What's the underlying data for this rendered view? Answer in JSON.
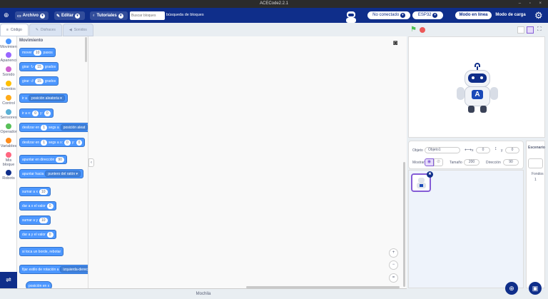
{
  "window": {
    "title": "ACECode2.2.1"
  },
  "menu": {
    "archivo": "Archivo",
    "editar": "Editar",
    "tutoriales": "Tutoriales",
    "search_placeholder": "Buscar bloques",
    "search_button": "búsqueda de bloques",
    "connection": "No conectado",
    "device": "ESP32",
    "mode_online": "Modo en línea",
    "mode_upload": "Modo de carga"
  },
  "tabs": [
    {
      "label": "Código"
    },
    {
      "label": "Disfraces"
    },
    {
      "label": "Sonidos"
    }
  ],
  "categories": [
    {
      "label": "Movimien",
      "color": "#4c97ff"
    },
    {
      "label": "Aparienci",
      "color": "#9966ff"
    },
    {
      "label": "Sonido",
      "color": "#cf63cf"
    },
    {
      "label": "Eventos",
      "color": "#ffbf00"
    },
    {
      "label": "Control",
      "color": "#ffab19"
    },
    {
      "label": "Sensores",
      "color": "#5cb1d6"
    },
    {
      "label": "Operador",
      "color": "#59c059"
    },
    {
      "label": "Variables",
      "color": "#ff8c1a"
    },
    {
      "label": "Mis bloque",
      "color": "#ff6680"
    },
    {
      "label": "Robots",
      "color": "#0f2e8a"
    }
  ],
  "palette": {
    "title": "Movimiento",
    "blocks": {
      "mover": {
        "a": "mover",
        "n": "10",
        "b": "pasos"
      },
      "girar_r": {
        "a": "girar",
        "n": "15",
        "b": "grados"
      },
      "girar_l": {
        "a": "girar",
        "n": "15",
        "b": "grados"
      },
      "ir_a": {
        "a": "ir a",
        "dd": "posición aleatoria"
      },
      "ir_a_xy": {
        "a": "ir a x:",
        "n1": "0",
        "b": "y:",
        "n2": "0"
      },
      "deslizar1": {
        "a": "deslizar en",
        "n": "1",
        "b": "segs a",
        "dd": "posición aleat"
      },
      "deslizar2": {
        "a": "deslizar en",
        "n": "1",
        "b": "segs a x:",
        "n2": "0",
        "c": "y:",
        "n3": "0"
      },
      "apuntar_dir": {
        "a": "apuntar en dirección",
        "n": "90"
      },
      "apuntar_hacia": {
        "a": "apuntar hacia",
        "dd": "puntero del ratón"
      },
      "sumar_x": {
        "a": "sumar a x",
        "n": "10"
      },
      "dar_x": {
        "a": "dar a x el valor",
        "n": "0"
      },
      "sumar_y": {
        "a": "sumar a y",
        "n": "10"
      },
      "dar_y": {
        "a": "dar a y el valor",
        "n": "0"
      },
      "rebotar": {
        "a": "si toca un borde, rebotar"
      },
      "estilo": {
        "a": "fijar estilo de rotación a",
        "dd": "izquierda-derech"
      },
      "posx": {
        "a": "posición en x"
      }
    }
  },
  "bottom": {
    "label": "Mochila"
  },
  "sprite_info": {
    "objeto_label": "Objeto",
    "objeto_value": "Objeto1",
    "x_label": "x",
    "x_value": "0",
    "y_label": "y",
    "y_value": "0",
    "mostrar_label": "Mostrar",
    "tamano_label": "Tamaño",
    "tamano_value": "200",
    "direccion_label": "Dirección",
    "direccion_value": "90"
  },
  "stage_col": {
    "title": "Escenario",
    "fondos_label": "Fondos",
    "fondos_value": "1"
  }
}
